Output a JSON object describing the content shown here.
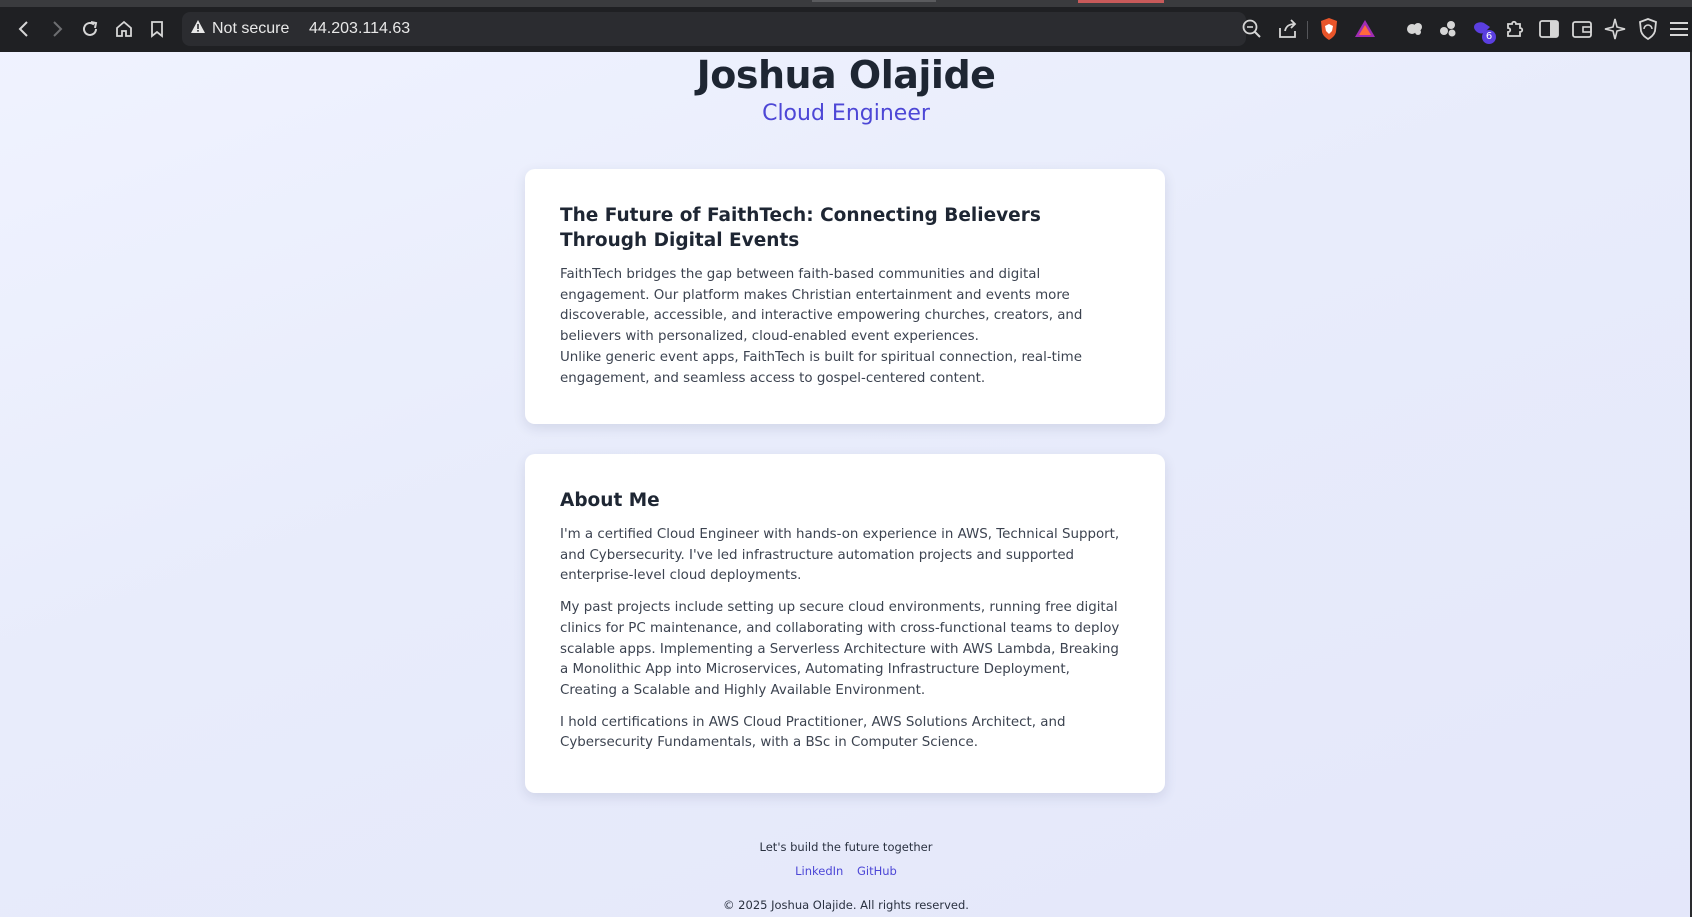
{
  "browser": {
    "security_label": "Not secure",
    "url": "44.203.114.63",
    "extension_badge": "6",
    "icons": [
      "back-icon",
      "forward-icon",
      "reload-icon",
      "home-icon",
      "bookmark-icon",
      "warning-icon",
      "zoom-icon",
      "share-icon",
      "brave-shields-icon",
      "brave-rewards-icon",
      "extension-icon",
      "puzzle-icon",
      "sidebar-icon",
      "wallet-icon",
      "leo-ai-icon",
      "vpn-icon",
      "menu-icon"
    ],
    "colors": {
      "chrome": "#1f2023",
      "url_box": "#2b2c30",
      "shield_orange": "#e8552a",
      "badge": "#5b3fe0"
    }
  },
  "header": {
    "name": "Joshua Olajide",
    "role": "Cloud Engineer"
  },
  "cards": [
    {
      "title": "The Future of FaithTech: Connecting Believers Through Digital Events",
      "paragraphs": [
        "FaithTech bridges the gap between faith-based communities and digital engagement. Our platform makes Christian entertainment and events more discoverable, accessible, and interactive empowering churches, creators, and believers with personalized, cloud-enabled event experiences.",
        "Unlike generic event apps, FaithTech is built for spiritual connection, real-time engagement, and seamless access to gospel-centered content."
      ]
    },
    {
      "title": "About Me",
      "paragraphs": [
        "I'm a certified Cloud Engineer with hands-on experience in AWS, Technical Support, and Cybersecurity. I've led infrastructure automation projects and supported enterprise-level cloud deployments.",
        "My past projects include setting up secure cloud environments, running free digital clinics for PC maintenance, and collaborating with cross-functional teams to deploy scalable apps. Implementing a Serverless Architecture with AWS Lambda, Breaking a Monolithic App into Microservices, Automating Infrastructure Deployment, Creating a Scalable and Highly Available Environment.",
        "I hold certifications in AWS Cloud Practitioner, AWS Solutions Architect, and Cybersecurity Fundamentals, with a BSc in Computer Science."
      ]
    }
  ],
  "footer": {
    "tagline": "Let's build the future together",
    "links": [
      "LinkedIn",
      "GitHub"
    ],
    "copyright": "© 2025 Joshua Olajide. All rights reserved."
  },
  "colors": {
    "accent": "#4d47d6",
    "heading": "#1e2633",
    "body_text": "#3c4350",
    "card_bg": "#ffffff"
  }
}
